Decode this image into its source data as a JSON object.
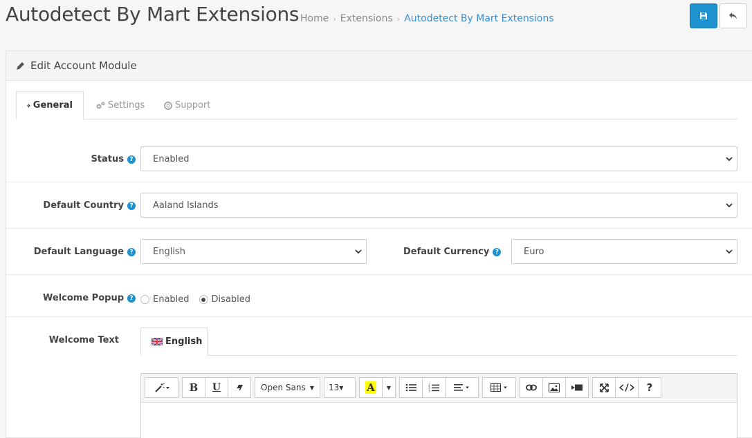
{
  "header": {
    "title": "Autodetect By Mart Extensions",
    "breadcrumb": [
      "Home",
      "Extensions",
      "Autodetect By Mart Extensions"
    ]
  },
  "panel": {
    "heading": "Edit Account Module"
  },
  "tabs": [
    {
      "label": "General",
      "active": true
    },
    {
      "label": "Settings",
      "active": false
    },
    {
      "label": "Support",
      "active": false
    }
  ],
  "form": {
    "status": {
      "label": "Status",
      "value": "Enabled"
    },
    "default_country": {
      "label": "Default Country",
      "value": "Aaland Islands"
    },
    "default_language": {
      "label": "Default Language",
      "value": "English"
    },
    "default_currency": {
      "label": "Default Currency",
      "value": "Euro"
    },
    "welcome_popup": {
      "label": "Welcome Popup",
      "options": [
        "Enabled",
        "Disabled"
      ],
      "selected": "Disabled"
    },
    "welcome_text": {
      "label": "Welcome Text",
      "language_tab": "English"
    }
  },
  "editor": {
    "font_family": "Open Sans",
    "font_size": "13"
  },
  "colors": {
    "primary": "#1e91cf",
    "link": "#3a8ed0"
  }
}
